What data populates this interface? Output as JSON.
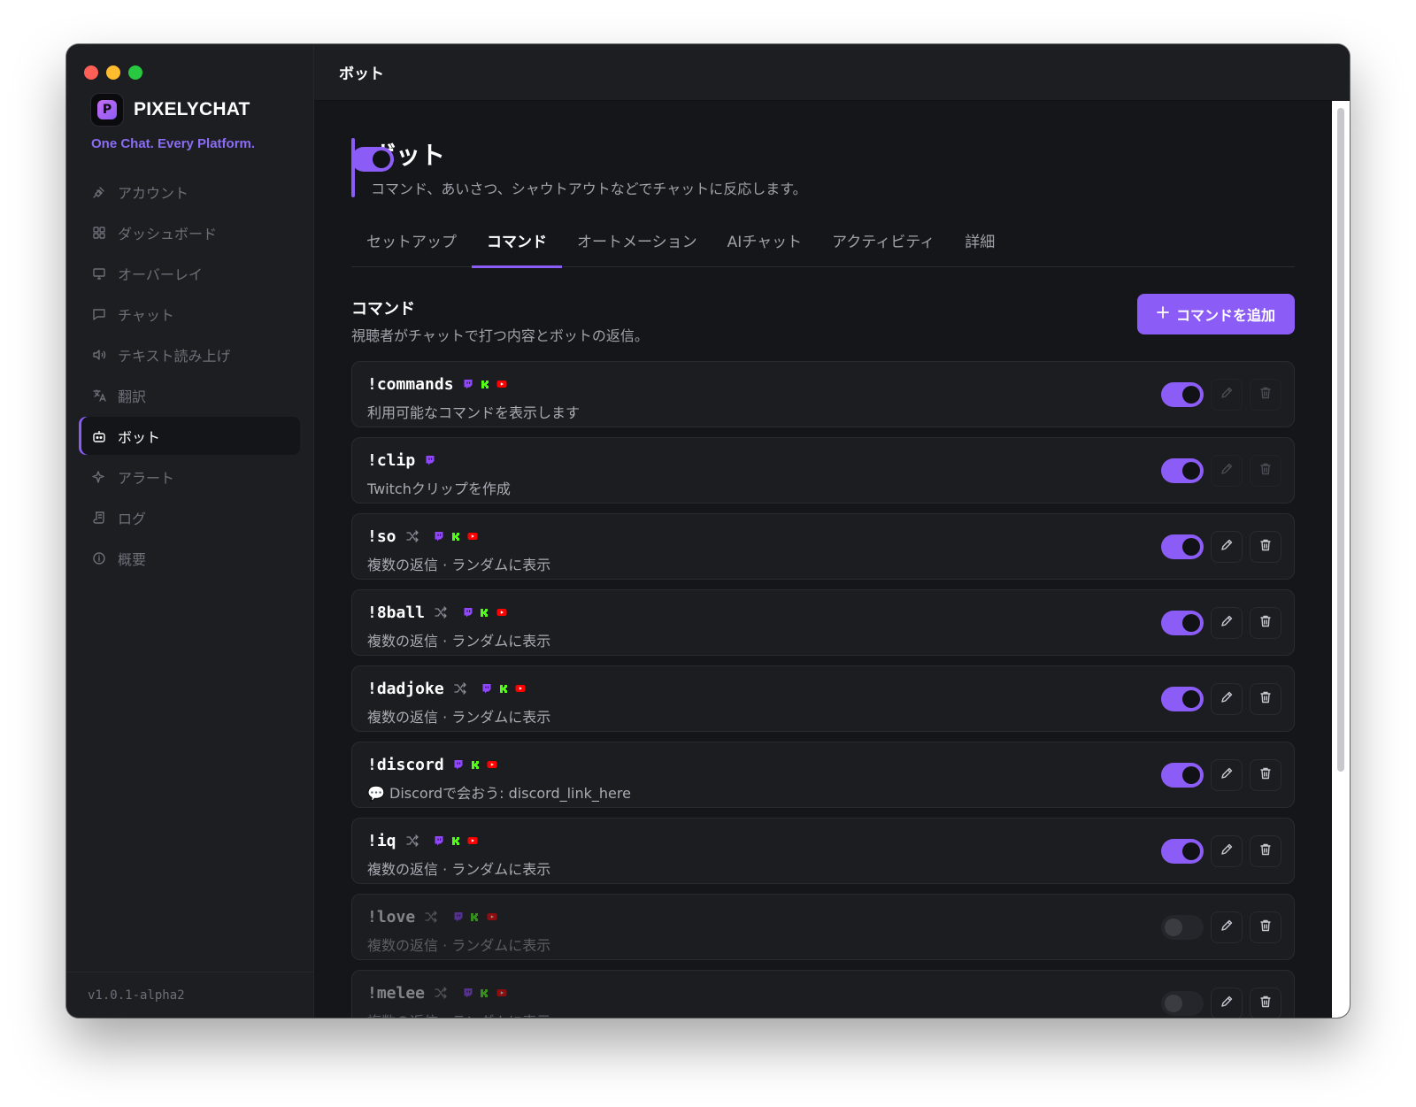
{
  "app": {
    "name": "PIXELYCHAT",
    "tagline": "One Chat. Every Platform.",
    "logo_letter": "P",
    "version": "v1.0.1-alpha2",
    "accent": "#8b5cf6"
  },
  "sidebar": {
    "items": [
      {
        "label": "アカウント",
        "icon": "plug-icon"
      },
      {
        "label": "ダッシュボード",
        "icon": "grid-icon"
      },
      {
        "label": "オーバーレイ",
        "icon": "monitor-icon"
      },
      {
        "label": "チャット",
        "icon": "chat-bubble-icon"
      },
      {
        "label": "テキスト読み上げ",
        "icon": "speaker-icon"
      },
      {
        "label": "翻訳",
        "icon": "translate-icon"
      },
      {
        "label": "ボット",
        "icon": "bot-icon",
        "active": true
      },
      {
        "label": "アラート",
        "icon": "sparkle-icon"
      },
      {
        "label": "ログ",
        "icon": "scroll-icon"
      },
      {
        "label": "概要",
        "icon": "info-icon"
      }
    ]
  },
  "topbar": {
    "title": "ボット"
  },
  "page": {
    "title": "ボット",
    "subtitle": "コマンド、あいさつ、シャウトアウトなどでチャットに反応します。",
    "enabled": true
  },
  "tabs": [
    {
      "label": "セットアップ"
    },
    {
      "label": "コマンド",
      "active": true
    },
    {
      "label": "オートメーション"
    },
    {
      "label": "AIチャット"
    },
    {
      "label": "アクティビティ"
    },
    {
      "label": "詳細"
    }
  ],
  "commands_section": {
    "title": "コマンド",
    "description": "視聴者がチャットで打つ内容とボットの返信。",
    "add_button": "コマンドを追加"
  },
  "platform_colors": {
    "twitch": "#9146ff",
    "kick": "#53fc18",
    "youtube": "#ff0000"
  },
  "commands": [
    {
      "name": "!commands",
      "random": false,
      "platforms": [
        "twitch",
        "kick",
        "youtube"
      ],
      "response": "利用可能なコマンドを表示します",
      "enabled": true,
      "builtin": true
    },
    {
      "name": "!clip",
      "random": false,
      "platforms": [
        "twitch"
      ],
      "response": "Twitchクリップを作成",
      "enabled": true,
      "builtin": true
    },
    {
      "name": "!so",
      "random": true,
      "platforms": [
        "twitch",
        "kick",
        "youtube"
      ],
      "response": "複数の返信 · ランダムに表示",
      "enabled": true,
      "builtin": false
    },
    {
      "name": "!8ball",
      "random": true,
      "platforms": [
        "twitch",
        "kick",
        "youtube"
      ],
      "response": "複数の返信 · ランダムに表示",
      "enabled": true,
      "builtin": false
    },
    {
      "name": "!dadjoke",
      "random": true,
      "platforms": [
        "twitch",
        "kick",
        "youtube"
      ],
      "response": "複数の返信 · ランダムに表示",
      "enabled": true,
      "builtin": false
    },
    {
      "name": "!discord",
      "random": false,
      "platforms": [
        "twitch",
        "kick",
        "youtube"
      ],
      "response": "💬 Discordで会おう: discord_link_here",
      "enabled": true,
      "builtin": false
    },
    {
      "name": "!iq",
      "random": true,
      "platforms": [
        "twitch",
        "kick",
        "youtube"
      ],
      "response": "複数の返信 · ランダムに表示",
      "enabled": true,
      "builtin": false
    },
    {
      "name": "!love",
      "random": true,
      "platforms": [
        "twitch",
        "kick",
        "youtube"
      ],
      "response": "複数の返信 · ランダムに表示",
      "enabled": false,
      "builtin": false
    },
    {
      "name": "!melee",
      "random": true,
      "platforms": [
        "twitch",
        "kick",
        "youtube"
      ],
      "response": "複数の返信 · ランダムに表示",
      "enabled": false,
      "builtin": false
    }
  ]
}
